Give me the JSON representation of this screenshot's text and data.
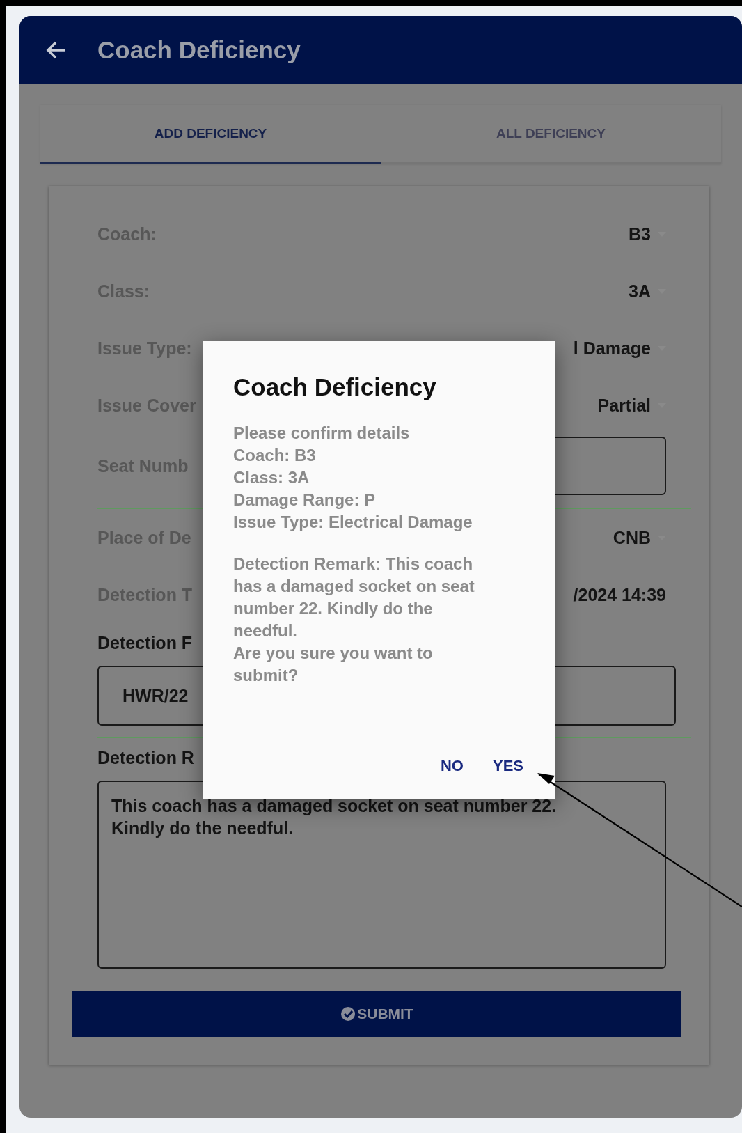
{
  "app_bar": {
    "title": "Coach Deficiency"
  },
  "tabs": [
    {
      "label": "ADD DEFICIENCY",
      "selected": true
    },
    {
      "label": "ALL DEFICIENCY",
      "selected": false
    }
  ],
  "form": {
    "rows": [
      {
        "kind": "dropdown",
        "label": "Coach:",
        "value": "B3"
      },
      {
        "kind": "dropdown",
        "label": "Class:",
        "value": "3A"
      },
      {
        "kind": "dropdown",
        "label": "Issue Type:",
        "value": "l Damage"
      },
      {
        "kind": "dropdown",
        "label": "Issue Cover",
        "value": "Partial"
      },
      {
        "kind": "input",
        "label": "Seat Numb"
      },
      {
        "kind": "dropdown",
        "label": "Place of De",
        "value": "CNB"
      },
      {
        "kind": "text",
        "label": "Detection T",
        "value": "/2024 14:39"
      },
      {
        "kind": "stacked-input",
        "label": "Detection F",
        "value": "HWR/22"
      },
      {
        "kind": "textarea",
        "label": "Detection R",
        "value": "This coach has a damaged socket on seat number 22. Kindly do the needful."
      }
    ],
    "submit": "SUBMIT"
  },
  "dialog": {
    "title": "Coach Deficiency",
    "lines": [
      "Please confirm details",
      "Coach: B3",
      "Class: 3A",
      "Damage Range: P",
      "Issue Type: Electrical Damage"
    ],
    "remark": "Detection Remark: This coach has a damaged socket on seat number 22. Kindly do the needful.",
    "question": "Are you sure you want to submit?",
    "buttons": [
      "NO",
      "YES"
    ]
  }
}
